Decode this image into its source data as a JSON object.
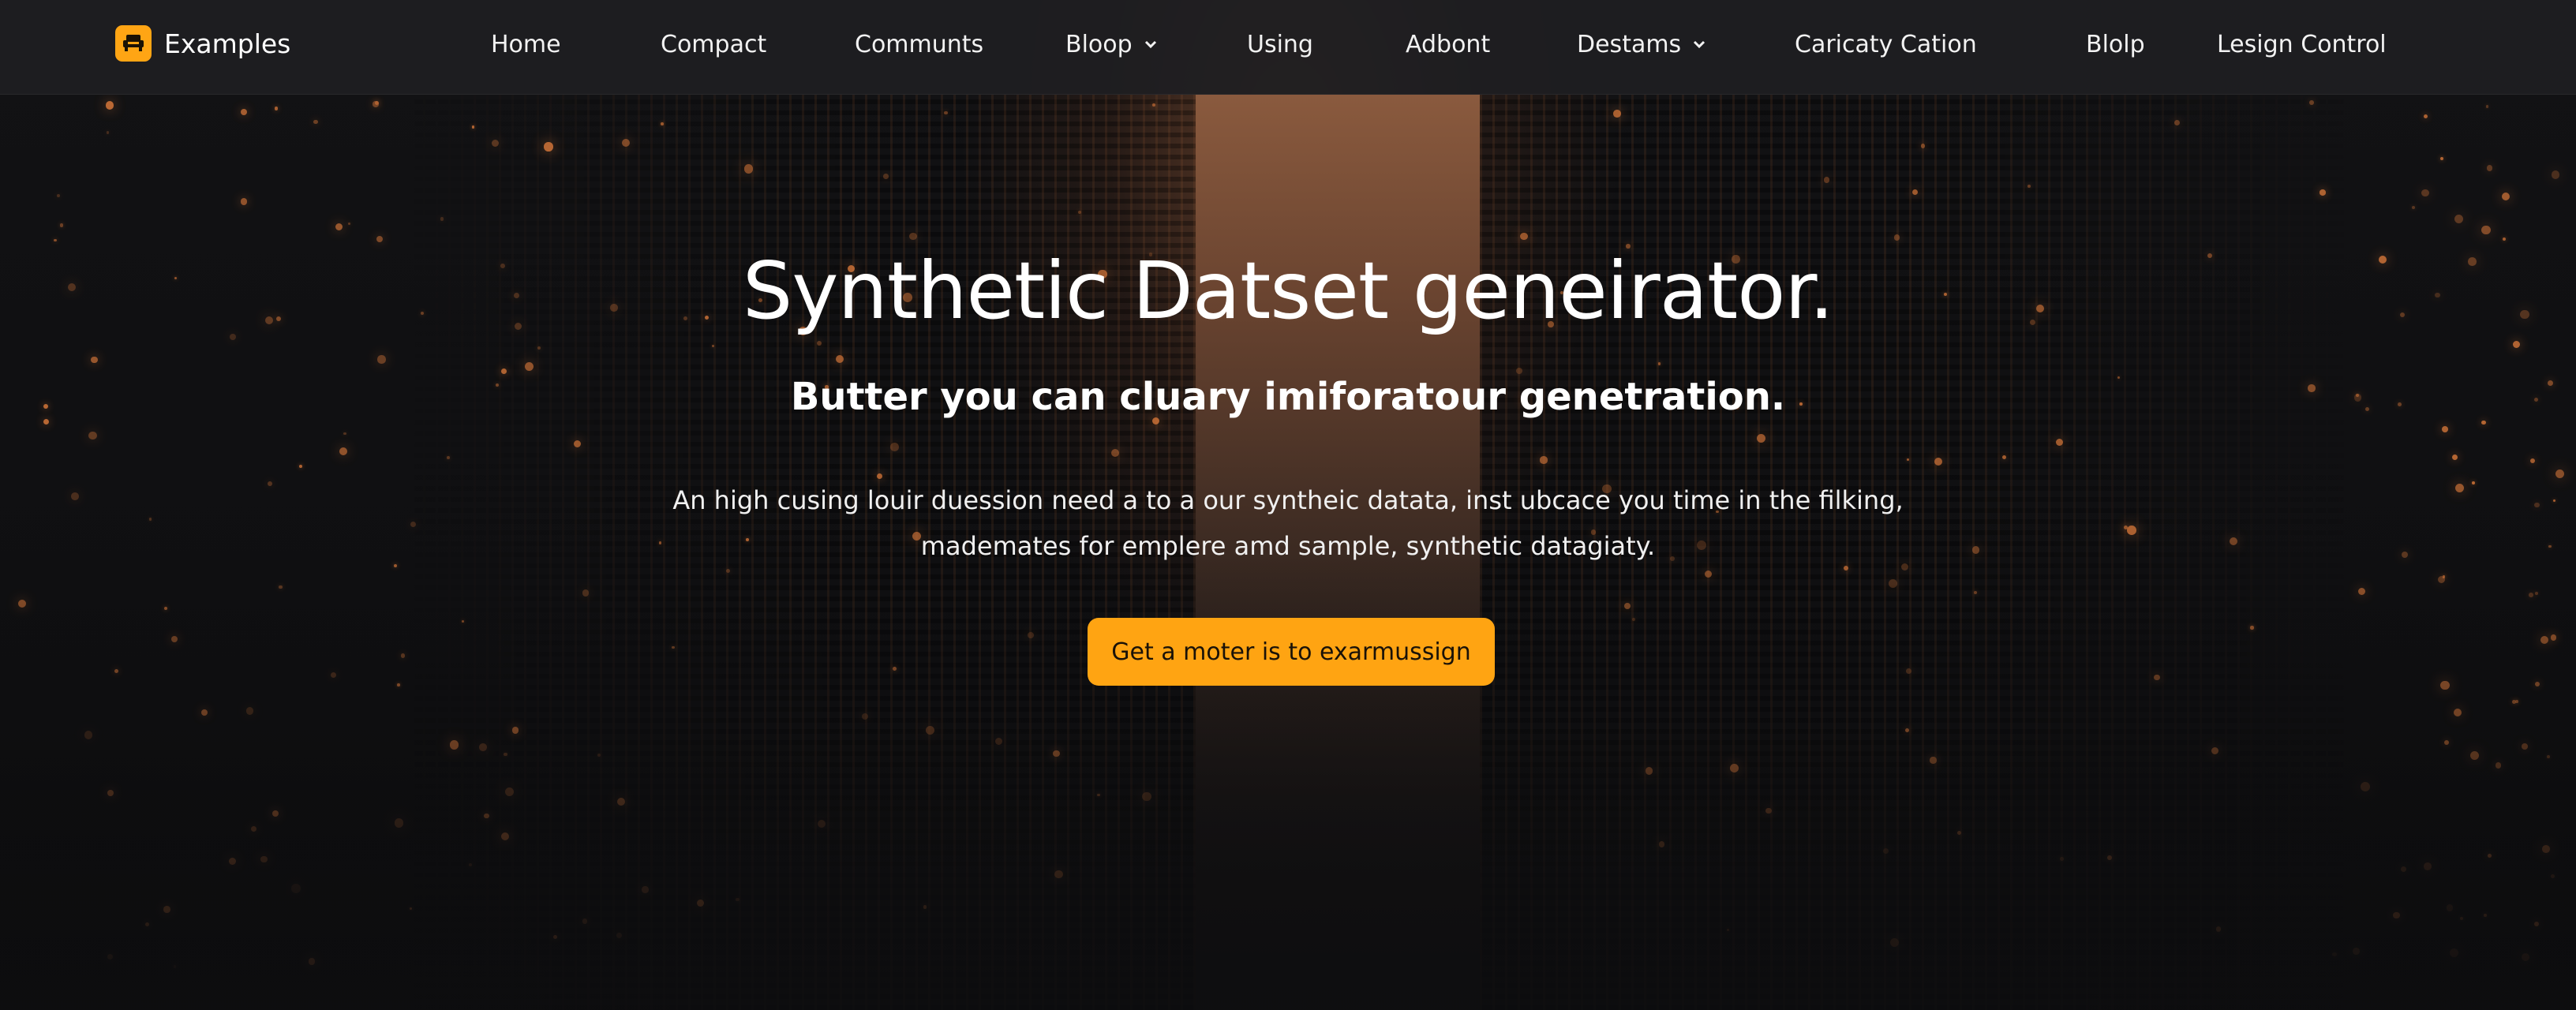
{
  "brand": {
    "name": "Examples",
    "logo_icon": "sofa-icon",
    "logo_color": "#ffa514"
  },
  "nav": {
    "items": [
      {
        "label": "Home",
        "has_dropdown": false
      },
      {
        "label": "Compact",
        "has_dropdown": false
      },
      {
        "label": "Communts",
        "has_dropdown": false
      },
      {
        "label": "Bloop",
        "has_dropdown": true
      },
      {
        "label": "Using",
        "has_dropdown": false
      },
      {
        "label": "Adbont",
        "has_dropdown": false
      },
      {
        "label": "Destams",
        "has_dropdown": true
      },
      {
        "label": "Caricaty Cation",
        "has_dropdown": false
      },
      {
        "label": "Blolp",
        "has_dropdown": false
      },
      {
        "label": "Lesign Control",
        "has_dropdown": false
      }
    ],
    "dropdown_icon": "chevron-down-icon"
  },
  "hero": {
    "title": "Synthetic Datset geneirator.",
    "subtitle": "Butter you can cluary imiforatour genetration.",
    "description_lines": [
      "An high cusing louir duession need a to a our syntheic datata, inst ubcace you time in the filking,",
      "mademates for emplere amd sample, synthetic datagiaty."
    ],
    "cta_label": "Get a moter is to exarmussign"
  },
  "colors": {
    "accent": "#ffa412",
    "nav_background": "#1e1e21",
    "page_background": "#0e0e10",
    "glow": "#d8783a"
  }
}
